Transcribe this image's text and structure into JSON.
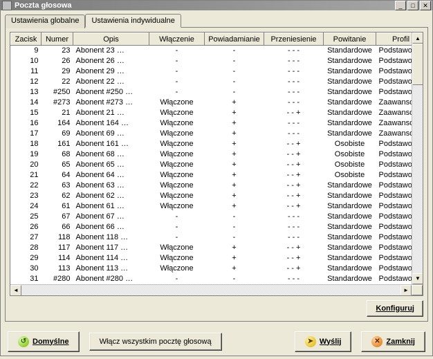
{
  "title": "Poczta głosowa",
  "winbtns": {
    "min": "_",
    "max": "□",
    "close": "✕"
  },
  "tabs": {
    "global": "Ustawienia globalne",
    "individual": "Ustawienia indywidualne"
  },
  "columns": {
    "zacisk": "Zacisk",
    "numer": "Numer",
    "opis": "Opis",
    "wlaczenie": "Włączenie",
    "powiadamianie": "Powiadamianie",
    "przeniesienie": "Przeniesienie",
    "powitanie": "Powitanie",
    "profil": "Profil"
  },
  "values": {
    "on": "Włączone",
    "dash": "-",
    "plus": "+",
    "dots": "-   -   -",
    "dotsplus": "-   -   +",
    "std": "Standardowe",
    "pers": "Osobiste",
    "basic": "Podstawowy",
    "adv": "Zaawansowany"
  },
  "rows": [
    {
      "z": "9",
      "n": "23",
      "o": "Abonent  23   …",
      "w": "dash",
      "p": "dash",
      "pr": "dots",
      "pw": "std",
      "pf": "basic"
    },
    {
      "z": "10",
      "n": "26",
      "o": "Abonent  26   …",
      "w": "dash",
      "p": "dash",
      "pr": "dots",
      "pw": "std",
      "pf": "basic"
    },
    {
      "z": "11",
      "n": "29",
      "o": "Abonent  29   …",
      "w": "dash",
      "p": "dash",
      "pr": "dots",
      "pw": "std",
      "pf": "basic"
    },
    {
      "z": "12",
      "n": "22",
      "o": "Abonent  22   …",
      "w": "dash",
      "p": "dash",
      "pr": "dots",
      "pw": "std",
      "pf": "basic"
    },
    {
      "z": "13",
      "n": "#250",
      "o": "Abonent  #250 …",
      "w": "dash",
      "p": "dash",
      "pr": "dots",
      "pw": "std",
      "pf": "basic"
    },
    {
      "z": "14",
      "n": "#273",
      "o": "Abonent  #273 …",
      "w": "on",
      "p": "plus",
      "pr": "dots",
      "pw": "std",
      "pf": "adv"
    },
    {
      "z": "15",
      "n": "21",
      "o": "Abonent  21   …",
      "w": "on",
      "p": "plus",
      "pr": "dotsplus",
      "pw": "std",
      "pf": "adv"
    },
    {
      "z": "16",
      "n": "164",
      "o": "Abonent  164  …",
      "w": "on",
      "p": "plus",
      "pr": "dots",
      "pw": "std",
      "pf": "adv"
    },
    {
      "z": "17",
      "n": "69",
      "o": "Abonent  69   …",
      "w": "on",
      "p": "plus",
      "pr": "dots",
      "pw": "std",
      "pf": "adv"
    },
    {
      "z": "18",
      "n": "161",
      "o": "Abonent  161  …",
      "w": "on",
      "p": "plus",
      "pr": "dotsplus",
      "pw": "pers",
      "pf": "basic"
    },
    {
      "z": "19",
      "n": "68",
      "o": "Abonent  68   …",
      "w": "on",
      "p": "plus",
      "pr": "dotsplus",
      "pw": "pers",
      "pf": "basic"
    },
    {
      "z": "20",
      "n": "65",
      "o": "Abonent  65   …",
      "w": "on",
      "p": "plus",
      "pr": "dotsplus",
      "pw": "pers",
      "pf": "basic"
    },
    {
      "z": "21",
      "n": "64",
      "o": "Abonent  64   …",
      "w": "on",
      "p": "plus",
      "pr": "dotsplus",
      "pw": "pers",
      "pf": "basic"
    },
    {
      "z": "22",
      "n": "63",
      "o": "Abonent  63   …",
      "w": "on",
      "p": "plus",
      "pr": "dotsplus",
      "pw": "std",
      "pf": "basic"
    },
    {
      "z": "23",
      "n": "62",
      "o": "Abonent  62   …",
      "w": "on",
      "p": "plus",
      "pr": "dotsplus",
      "pw": "std",
      "pf": "basic"
    },
    {
      "z": "24",
      "n": "61",
      "o": "Abonent  61   …",
      "w": "on",
      "p": "plus",
      "pr": "dotsplus",
      "pw": "std",
      "pf": "basic"
    },
    {
      "z": "25",
      "n": "67",
      "o": "Abonent  67   …",
      "w": "dash",
      "p": "dash",
      "pr": "dots",
      "pw": "std",
      "pf": "basic"
    },
    {
      "z": "26",
      "n": "66",
      "o": "Abonent  66   …",
      "w": "dash",
      "p": "dash",
      "pr": "dots",
      "pw": "std",
      "pf": "basic"
    },
    {
      "z": "27",
      "n": "118",
      "o": "Abonent  118  …",
      "w": "dash",
      "p": "dash",
      "pr": "dots",
      "pw": "std",
      "pf": "basic"
    },
    {
      "z": "28",
      "n": "117",
      "o": "Abonent  117  …",
      "w": "on",
      "p": "plus",
      "pr": "dotsplus",
      "pw": "std",
      "pf": "basic"
    },
    {
      "z": "29",
      "n": "114",
      "o": "Abonent  114  …",
      "w": "on",
      "p": "plus",
      "pr": "dotsplus",
      "pw": "std",
      "pf": "basic"
    },
    {
      "z": "30",
      "n": "113",
      "o": "Abonent  113  …",
      "w": "on",
      "p": "plus",
      "pr": "dotsplus",
      "pw": "std",
      "pf": "basic"
    },
    {
      "z": "31",
      "n": "#280",
      "o": "Abonent  #280 …",
      "w": "dash",
      "p": "dash",
      "pr": "dots",
      "pw": "std",
      "pf": "basic"
    }
  ],
  "buttons": {
    "configure": "Konfiguruj",
    "defaults": "Domyślne",
    "enable_all": "Włącz wszystkim pocztę głosową",
    "send": "Wyślij",
    "close": "Zamknij"
  }
}
